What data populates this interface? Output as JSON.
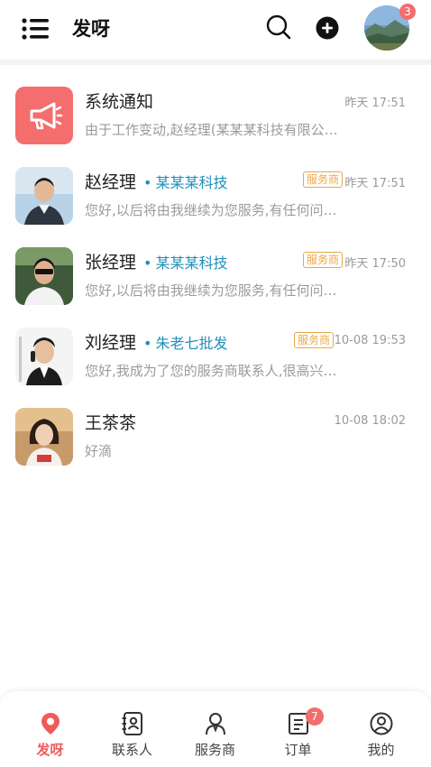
{
  "header": {
    "title": "发呀",
    "icons": {
      "menu": "list-menu-icon",
      "search": "search-icon",
      "add": "add-circle-icon"
    },
    "avatar_badge": "3"
  },
  "chats": [
    {
      "name": "系统通知",
      "company": "",
      "badge": "",
      "time": "昨天 17:51",
      "preview": "由于工作变动,赵经理(某某某科技有限公…",
      "avatar": "megaphone-icon"
    },
    {
      "name": "赵经理",
      "company": "某某某科技",
      "badge": "服务商",
      "time": "昨天 17:51",
      "preview": "您好,以后将由我继续为您服务,有任何问…",
      "avatar": "person-photo"
    },
    {
      "name": "张经理",
      "company": "某某某科技",
      "badge": "服务商",
      "time": "昨天 17:50",
      "preview": "您好,以后将由我继续为您服务,有任何问…",
      "avatar": "person-photo"
    },
    {
      "name": "刘经理",
      "company": "朱老七批发",
      "badge": "服务商",
      "time": "10-08 19:53",
      "preview": "您好,我成为了您的服务商联系人,很高兴…",
      "avatar": "person-photo"
    },
    {
      "name": "王茶茶",
      "company": "",
      "badge": "",
      "time": "10-08 18:02",
      "preview": "好滴",
      "avatar": "person-photo"
    }
  ],
  "tabs": [
    {
      "label": "发呀",
      "icon": "location-pin-icon",
      "active": true
    },
    {
      "label": "联系人",
      "icon": "contacts-book-icon"
    },
    {
      "label": "服务商",
      "icon": "service-person-icon"
    },
    {
      "label": "订单",
      "icon": "order-list-icon",
      "badge": "7"
    },
    {
      "label": "我的",
      "icon": "profile-icon"
    }
  ],
  "colors": {
    "accent": "#ef5b5b",
    "company": "#1f8fb8",
    "tag": "#e8a84a",
    "badge": "#f26d6d"
  }
}
